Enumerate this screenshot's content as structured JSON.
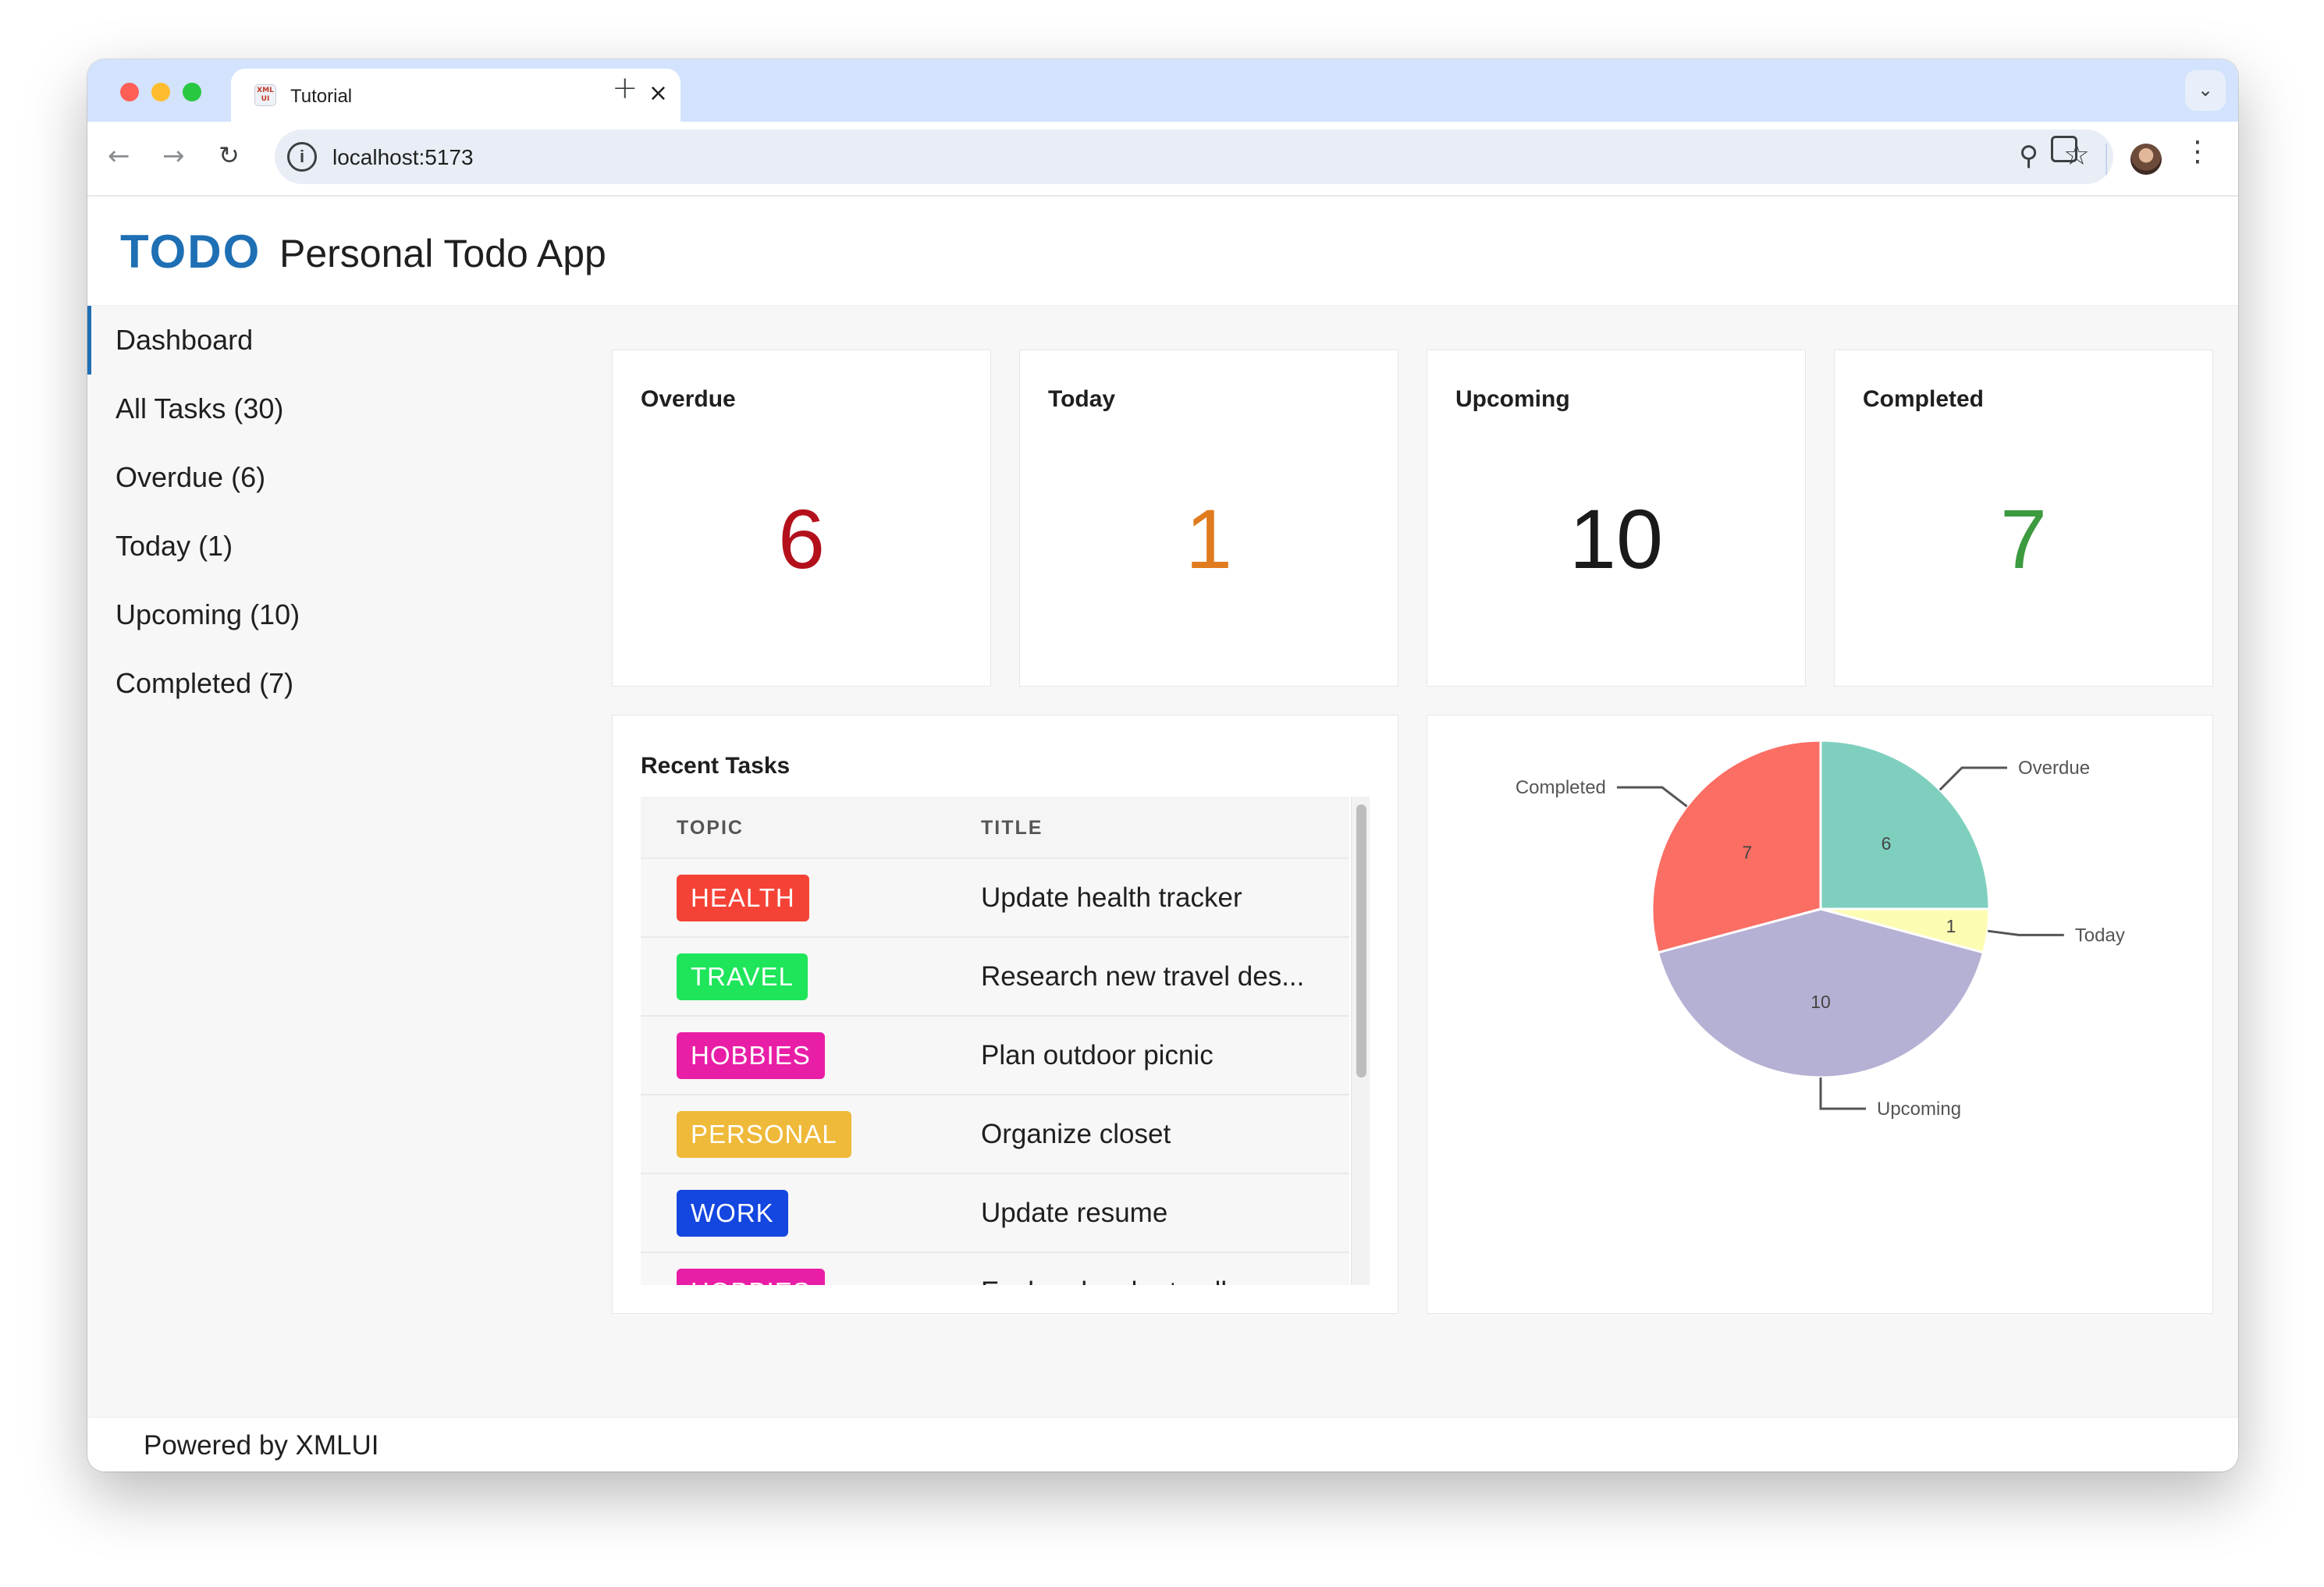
{
  "browser": {
    "tab_title": "Tutorial",
    "favicon_text": "XML UI",
    "tab_close": "×",
    "new_tab": "+",
    "tab_menu": "⌄",
    "url": "localhost:5173"
  },
  "app": {
    "logo": "TODO",
    "title": "Personal Todo App",
    "footer": "Powered by XMLUI"
  },
  "sidebar": {
    "items": [
      {
        "label": "Dashboard",
        "active": true
      },
      {
        "label": "All Tasks (30)",
        "active": false
      },
      {
        "label": "Overdue (6)",
        "active": false
      },
      {
        "label": "Today (1)",
        "active": false
      },
      {
        "label": "Upcoming (10)",
        "active": false
      },
      {
        "label": "Completed (7)",
        "active": false
      }
    ]
  },
  "stats": [
    {
      "label": "Overdue",
      "value": "6",
      "color": "#b3101c"
    },
    {
      "label": "Today",
      "value": "1",
      "color": "#e07b1f"
    },
    {
      "label": "Upcoming",
      "value": "10",
      "color": "#1a1a1a"
    },
    {
      "label": "Completed",
      "value": "7",
      "color": "#3c9a3f"
    }
  ],
  "recent_tasks": {
    "title": "Recent Tasks",
    "columns": [
      "TOPIC",
      "TITLE"
    ],
    "rows": [
      {
        "topic": "HEALTH",
        "color": "#f44336",
        "title": "Update health tracker"
      },
      {
        "topic": "TRAVEL",
        "color": "#1ee55a",
        "title": "Research new travel des..."
      },
      {
        "topic": "HOBBIES",
        "color": "#e91ea7",
        "title": "Plan outdoor picnic"
      },
      {
        "topic": "PERSONAL",
        "color": "#efb93a",
        "title": "Organize closet"
      },
      {
        "topic": "WORK",
        "color": "#1446e0",
        "title": "Update resume"
      },
      {
        "topic": "HOBBIES",
        "color": "#e91ea7",
        "title": "Explore local art gallery"
      }
    ]
  },
  "chart_data": {
    "type": "pie",
    "categories": [
      "Overdue",
      "Today",
      "Upcoming",
      "Completed"
    ],
    "values": [
      6,
      1,
      10,
      7
    ],
    "colors": [
      "#7fcfbe",
      "#fdfcb3",
      "#b5b1d4",
      "#fb6e64"
    ],
    "labels_shown": true
  }
}
